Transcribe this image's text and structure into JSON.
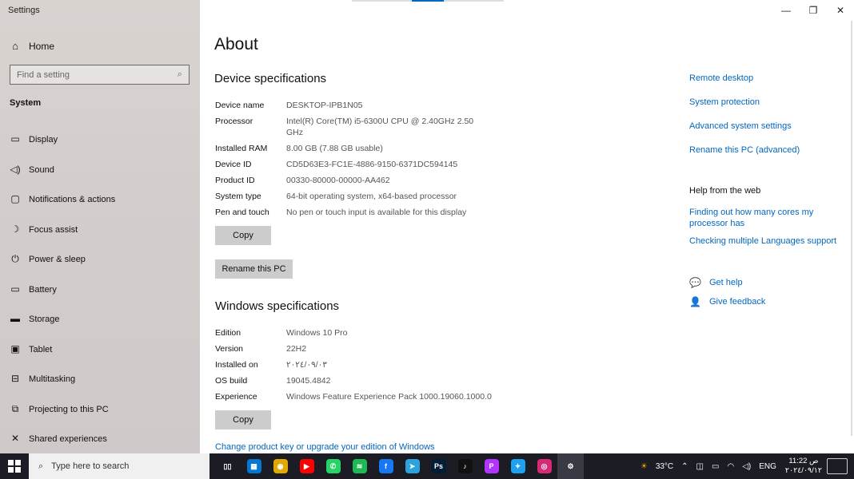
{
  "window": {
    "title": "Settings"
  },
  "sidebar": {
    "home_label": "Home",
    "search_placeholder": "Find a setting",
    "section": "System",
    "items": [
      {
        "label": "Display",
        "icon": "monitor-icon"
      },
      {
        "label": "Sound",
        "icon": "speaker-icon"
      },
      {
        "label": "Notifications & actions",
        "icon": "notifications-icon"
      },
      {
        "label": "Focus assist",
        "icon": "moon-icon"
      },
      {
        "label": "Power & sleep",
        "icon": "power-icon"
      },
      {
        "label": "Battery",
        "icon": "battery-icon"
      },
      {
        "label": "Storage",
        "icon": "storage-icon"
      },
      {
        "label": "Tablet",
        "icon": "tablet-icon"
      },
      {
        "label": "Multitasking",
        "icon": "multitasking-icon"
      },
      {
        "label": "Projecting to this PC",
        "icon": "projecting-icon"
      },
      {
        "label": "Shared experiences",
        "icon": "shared-icon"
      }
    ]
  },
  "main": {
    "title": "About",
    "device_specs": {
      "heading": "Device specifications",
      "rows": [
        {
          "key": "Device name",
          "value": "DESKTOP-IPB1N05"
        },
        {
          "key": "Processor",
          "value": "Intel(R) Core(TM) i5-6300U CPU @ 2.40GHz   2.50 GHz"
        },
        {
          "key": "Installed RAM",
          "value": "8.00 GB (7.88 GB usable)"
        },
        {
          "key": "Device ID",
          "value": "CD5D63E3-FC1E-4886-9150-6371DC594145"
        },
        {
          "key": "Product ID",
          "value": "00330-80000-00000-AA462"
        },
        {
          "key": "System type",
          "value": "64-bit operating system, x64-based processor"
        },
        {
          "key": "Pen and touch",
          "value": "No pen or touch input is available for this display"
        }
      ],
      "copy_label": "Copy",
      "rename_label": "Rename this PC"
    },
    "windows_specs": {
      "heading": "Windows specifications",
      "rows": [
        {
          "key": "Edition",
          "value": "Windows 10 Pro"
        },
        {
          "key": "Version",
          "value": "22H2"
        },
        {
          "key": "Installed on",
          "value": "٢٠٢٤/٠٩/٠٣"
        },
        {
          "key": "OS build",
          "value": "19045.4842"
        },
        {
          "key": "Experience",
          "value": "Windows Feature Experience Pack 1000.19060.1000.0"
        }
      ],
      "copy_label": "Copy"
    },
    "upgrade_link": "Change product key or upgrade your edition of Windows"
  },
  "related": {
    "links": [
      "Remote desktop",
      "System protection",
      "Advanced system settings",
      "Rename this PC (advanced)"
    ],
    "help_heading": "Help from the web",
    "help_links": [
      "Finding out how many cores my processor has",
      "Checking multiple Languages support"
    ],
    "get_help": "Get help",
    "give_feedback": "Give feedback"
  },
  "taskbar": {
    "search_placeholder": "Type here to search",
    "temperature": "33°C",
    "language": "ENG",
    "time": "11:22 ص",
    "date": "٢٠٢٤/٠٩/١٢",
    "apps": [
      {
        "name": "task-view",
        "color": "#1c1c24",
        "glyph": "▯▯"
      },
      {
        "name": "store",
        "color": "#0078d4",
        "glyph": "▦"
      },
      {
        "name": "chrome",
        "color": "#e0a800",
        "glyph": "◉"
      },
      {
        "name": "youtube",
        "color": "#ff0000",
        "glyph": "▶"
      },
      {
        "name": "whatsapp",
        "color": "#25d366",
        "glyph": "✆"
      },
      {
        "name": "spotify",
        "color": "#1db954",
        "glyph": "≋"
      },
      {
        "name": "facebook",
        "color": "#1877f2",
        "glyph": "f"
      },
      {
        "name": "telegram",
        "color": "#2aa3df",
        "glyph": "➤"
      },
      {
        "name": "photoshop",
        "color": "#001e36",
        "glyph": "Ps"
      },
      {
        "name": "tiktok",
        "color": "#111111",
        "glyph": "♪"
      },
      {
        "name": "picsart",
        "color": "#b234ff",
        "glyph": "P"
      },
      {
        "name": "twitter",
        "color": "#1da1f2",
        "glyph": "✦"
      },
      {
        "name": "instagram",
        "color": "#d62976",
        "glyph": "◎"
      },
      {
        "name": "settings",
        "color": "#3a3a44",
        "glyph": "⚙"
      }
    ]
  },
  "colors": {
    "accent": "#0067c0",
    "sidebar_bg": "#d3cdcc",
    "taskbar_bg": "#1c1c24"
  }
}
